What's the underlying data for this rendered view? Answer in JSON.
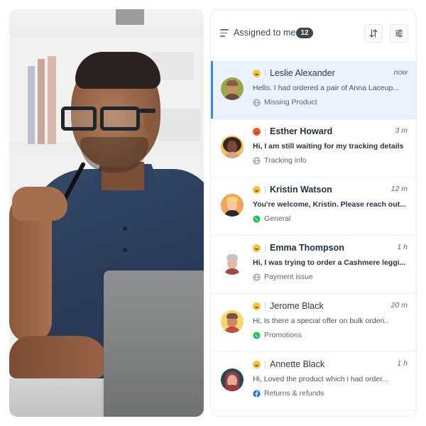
{
  "header": {
    "title": "Assigned to me",
    "count": "12",
    "sort_icon": "sort-arrows-icon",
    "filter_icon": "sliders-icon",
    "menu_icon": "menu-lines-icon"
  },
  "colors": {
    "accent": "#3d8ae6",
    "active_row_bg": "#e9f2fd",
    "badge_bg": "#3b4650",
    "whatsapp": "#29c05a",
    "facebook": "#1877f2"
  },
  "conversations": [
    {
      "name": "Leslie Alexander",
      "time": "now",
      "preview": "Hello. I had ordered a pair of Anna Laceup...",
      "channel": "web",
      "channel_icon": "globe-icon",
      "tag": "Missing Product",
      "mood": "neutral",
      "unread": false,
      "active": true
    },
    {
      "name": "Esther Howard",
      "time": "3 m",
      "preview": "Hi, I am still waiting for my tracking details",
      "channel": "web",
      "channel_icon": "globe-icon",
      "tag": "Tracking info",
      "mood": "angry",
      "unread": true,
      "active": false
    },
    {
      "name": "Kristin Watson",
      "time": "12 m",
      "preview": "You're welcome, Kristin. Please reach out...",
      "channel": "whatsapp",
      "channel_icon": "whatsapp-icon",
      "tag": "General",
      "mood": "neutral",
      "unread": true,
      "active": false
    },
    {
      "name": "Emma Thompson",
      "time": "1 h",
      "preview": "Hi, I was trying to order a Cashmere leggi...",
      "channel": "web",
      "channel_icon": "globe-icon",
      "tag": "Payment issue",
      "mood": "neutral",
      "unread": true,
      "active": false
    },
    {
      "name": "Jerome Black",
      "time": "20 m",
      "preview": "Hi, Is there a special offer on bulk orderi..",
      "channel": "whatsapp",
      "channel_icon": "whatsapp-icon",
      "tag": "Promotions",
      "mood": "neutral",
      "unread": false,
      "active": false
    },
    {
      "name": "Annette Black",
      "time": "1 h",
      "preview": "Hi, Loved the product which i had order...",
      "channel": "facebook",
      "channel_icon": "facebook-icon",
      "tag": "Returns & refunds",
      "mood": "neutral",
      "unread": false,
      "active": false
    }
  ]
}
